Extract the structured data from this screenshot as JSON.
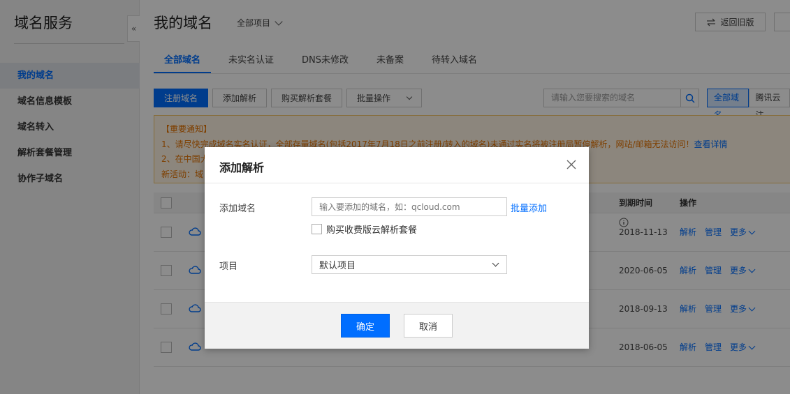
{
  "sidebar": {
    "title": "域名服务",
    "collapse_icon": "«",
    "items": [
      {
        "label": "我的域名",
        "active": true
      },
      {
        "label": "域名信息模板"
      },
      {
        "label": "域名转入"
      },
      {
        "label": "解析套餐管理"
      },
      {
        "label": "协作子域名"
      }
    ]
  },
  "header": {
    "title": "我的域名",
    "project_selector": "全部项目",
    "return_button": "返回旧版"
  },
  "tabs": [
    {
      "label": "全部域名",
      "active": true
    },
    {
      "label": "未实名认证"
    },
    {
      "label": "DNS未修改"
    },
    {
      "label": "未备案"
    },
    {
      "label": "待转入域名"
    }
  ],
  "toolbar": {
    "register": "注册域名",
    "add_resolve": "添加解析",
    "buy_package": "购买解析套餐",
    "batch": "批量操作",
    "search_placeholder": "请输入您要搜索的域名",
    "filter_all": "全部域名",
    "filter_tencent": "腾讯云注"
  },
  "notice": {
    "title": "【重要通知】",
    "line1": "1、请尽快完成域名实名认证，全部存量域名(包括2017年7月18日之前注册/转入的域名)未通过实名将被注册局暂停解析，网站/邮箱无法访问！",
    "line1_link": "查看详情",
    "line2": "2、在中国大",
    "line3": "新活动：域"
  },
  "table": {
    "headers": {
      "expire": "到期时间",
      "ops": "操作"
    },
    "rows": [
      {
        "expire": "2018-11-13"
      },
      {
        "expire": "2020-06-05"
      },
      {
        "expire": "2018-09-13"
      },
      {
        "expire": "2018-06-05"
      }
    ],
    "ops": {
      "resolve": "解析",
      "manage": "管理",
      "more": "更多"
    }
  },
  "modal": {
    "title": "添加解析",
    "domain_label": "添加域名",
    "domain_placeholder": "输入要添加的域名，如：qcloud.com",
    "bulk_add": "批量添加",
    "package_checkbox": "购买收费版云解析套餐",
    "project_label": "项目",
    "project_value": "默认项目",
    "ok": "确定",
    "cancel": "取消"
  },
  "colors": {
    "accent": "#006eff",
    "notice_text": "#e57300",
    "notice_bg": "#fff4e3"
  }
}
